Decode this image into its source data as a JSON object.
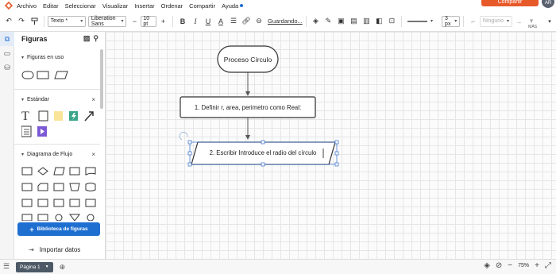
{
  "colors": {
    "brand_orange": "#e8592a",
    "accent_blue": "#1f6fd1",
    "page_tab": "#4d5966",
    "menu_dot": "#1f6fd1",
    "avatar": "#5a6270",
    "selection": "#4a7bd0",
    "thumb_yellow": "#f9e49a",
    "thumb_green": "#3aa58a",
    "thumb_purple": "#7c5ad6"
  },
  "menu": {
    "items": [
      "Archivo",
      "Editar",
      "Seleccionar",
      "Visualizar",
      "Insertar",
      "Ordenar",
      "Compartir",
      "Ayuda"
    ],
    "share_label": "Compartir",
    "avatar_initials": "AR"
  },
  "toolbar": {
    "text_style": "Texto *",
    "font_family": "Liberation Sans",
    "font_size": "10 pt",
    "saving_label": "Guardando...",
    "line_width": "3 px",
    "arrow_style": "Ninguno",
    "more_label": "MÁS"
  },
  "panel": {
    "title": "Figuras",
    "sections": {
      "in_use": "Figuras en uso",
      "standard": "Estándar",
      "flowchart": "Diagrama de Flujo"
    },
    "library_button": "Biblioteca de figuras",
    "import_label": "Importar datos"
  },
  "diagram": {
    "start_label": "Proceso Círculo",
    "step1_label": "1. Definir r, area, perimetro como Real:",
    "step2_label": "2. Escribir Introduce el radio del círculo"
  },
  "bottom": {
    "page_tab": "Página 1",
    "zoom": "75%"
  }
}
